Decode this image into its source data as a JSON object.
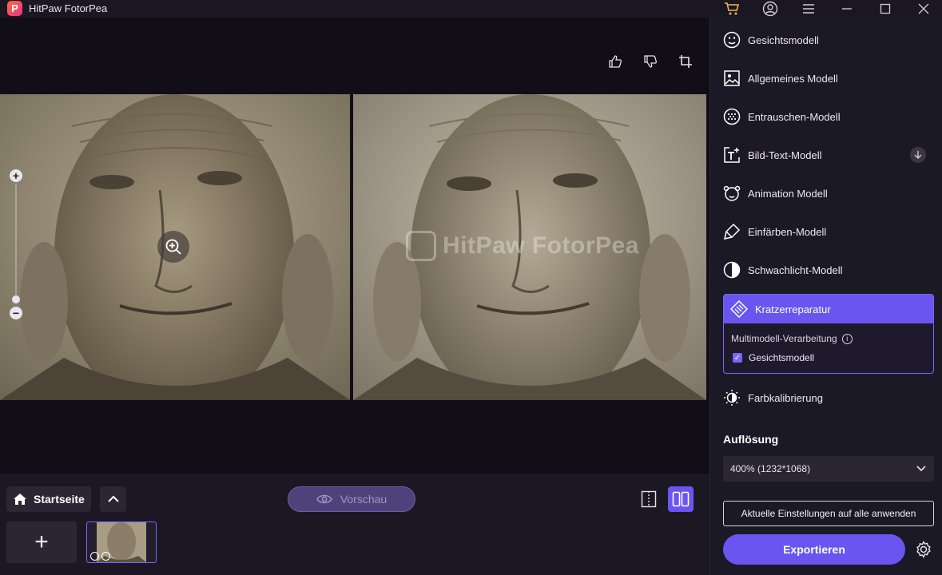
{
  "app": {
    "title": "HitPaw FotorPea"
  },
  "toolbar": {
    "thumbs_up": "thumbs-up-icon",
    "thumbs_down": "thumbs-down-icon",
    "crop": "crop-icon"
  },
  "canvas": {
    "watermark": "HitPaw FotorPea"
  },
  "bottom": {
    "home_label": "Startseite",
    "preview_label": "Vorschau",
    "add_label": "+"
  },
  "models": [
    {
      "label": "Gesichtsmodell",
      "icon": "face-icon"
    },
    {
      "label": "Allgemeines Modell",
      "icon": "image-icon"
    },
    {
      "label": "Entrauschen-Modell",
      "icon": "denoise-icon"
    },
    {
      "label": "Bild-Text-Modell",
      "icon": "text-icon"
    },
    {
      "label": "Animation Modell",
      "icon": "bear-icon"
    },
    {
      "label": "Einfärben-Modell",
      "icon": "brush-icon"
    },
    {
      "label": "Schwachlicht-Modell",
      "icon": "half-circle-icon"
    }
  ],
  "active_model": {
    "label": "Kratzerreparatur",
    "multi_label": "Multimodell-Verarbeitung",
    "checkbox_label": "Gesichtsmodell",
    "checked": true
  },
  "color_calibration": {
    "label": "Farbkalibrierung"
  },
  "resolution": {
    "title": "Auflösung",
    "value": "400% (1232*1068)"
  },
  "actions": {
    "apply_all": "Aktuelle Einstellungen auf alle anwenden",
    "export": "Exportieren"
  },
  "colors": {
    "accent": "#6a55f0",
    "bg": "#141119",
    "panel": "#1c1926"
  }
}
